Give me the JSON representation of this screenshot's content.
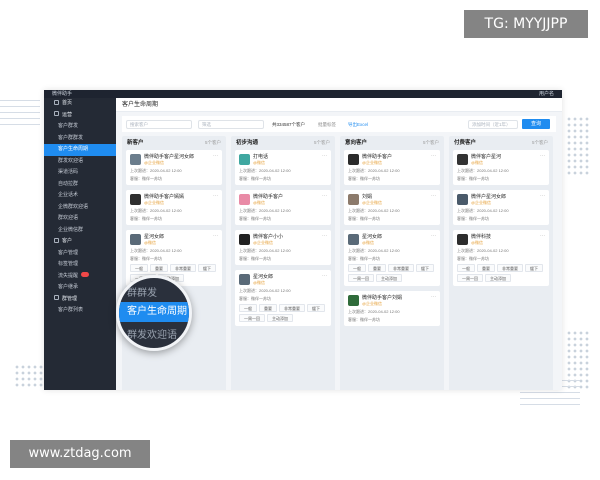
{
  "watermarks": {
    "top": "TG: MYYJJPP",
    "bottom": "www.ztdag.com"
  },
  "app": {
    "title": "微伴助手",
    "user": "用户名",
    "page_title": "客户生命周期",
    "accent": "#1f8cf0"
  },
  "sidebar": {
    "items": [
      {
        "label": "首页",
        "group": true
      },
      {
        "label": "运营",
        "group": true
      },
      {
        "label": "客户群发"
      },
      {
        "label": "客户群群发"
      },
      {
        "label": "客户生命周期",
        "active": true
      },
      {
        "label": "群发欢迎语"
      },
      {
        "label": "渠道活码"
      },
      {
        "label": "自动拉群"
      },
      {
        "label": "企业话术"
      },
      {
        "label": "企微群欢迎语"
      },
      {
        "label": "群欢迎语"
      },
      {
        "label": "企业微信群"
      },
      {
        "label": "客户",
        "group": true
      },
      {
        "label": "客户管理"
      },
      {
        "label": "标签管理"
      },
      {
        "label": "流失提醒",
        "badge": true
      },
      {
        "label": "客户继承"
      },
      {
        "label": "群管理",
        "group": true
      },
      {
        "label": "客户群列表"
      }
    ]
  },
  "lens": {
    "lines": [
      "群群发",
      "客户生命周期",
      "群发欢迎语"
    ]
  },
  "filter": {
    "search_placeholder": "搜索客户",
    "select_placeholder": "筛选",
    "total": "共334587个客户",
    "link1": "批量标签",
    "link2": "导出Excel",
    "date_placeholder": "添加时间（近1年）",
    "query": "查询"
  },
  "columns": [
    {
      "title": "新客户",
      "count": "5个客户",
      "cards": [
        {
          "name": "微伴助手客户星河女郎",
          "company": "@企业微信",
          "time": "上次跟进：2020-04-02 12:00",
          "owner": "客服：微伴一苏坊",
          "avatar": "#6b7d8c"
        },
        {
          "name": "微伴助手客户嫣嫣",
          "company": "@企业微信",
          "time": "上次跟进：2020-04-02 12:00",
          "owner": "客服：微伴一苏坊",
          "avatar": "#2f2f2f"
        },
        {
          "name": "星河女郎",
          "company": "@微信",
          "time": "上次跟进：2020-04-02 12:00",
          "owner": "客服：微伴一苏坊",
          "avatar": "#5a6a78",
          "tags": [
            "一般",
            "重要",
            "非常重要",
            "缓下",
            "一周一回",
            "主动添加"
          ]
        }
      ]
    },
    {
      "title": "初步沟通",
      "count": "5个客户",
      "cards": [
        {
          "name": "打电话",
          "company": "@微信",
          "time": "上次跟进：2020-04-02 12:00",
          "owner": "客服：微伴一苏坊",
          "avatar": "#3fa7a0"
        },
        {
          "name": "微伴助手客户",
          "company": "@微信",
          "time": "上次跟进：2020-04-02 12:00",
          "owner": "客服：微伴一苏坊",
          "avatar": "#e98aa6"
        },
        {
          "name": "微伴客户小小",
          "company": "@企业微信",
          "time": "上次跟进：2020-04-02 12:00",
          "owner": "客服：微伴一苏坊",
          "avatar": "#222222"
        },
        {
          "name": "星河女郎",
          "company": "@微信",
          "time": "上次跟进：2020-04-02 12:00",
          "owner": "客服：微伴一苏坊",
          "avatar": "#5a6a78",
          "tags": [
            "一般",
            "重要",
            "非常重要",
            "缓下",
            "一周一回",
            "主动添加"
          ]
        }
      ]
    },
    {
      "title": "意向客户",
      "count": "5个客户",
      "cards": [
        {
          "name": "微伴助手客户",
          "company": "@企业微信",
          "time": "上次跟进：2020-04-02 12:00",
          "owner": "客服：微伴一苏坊",
          "avatar": "#2b2b2b"
        },
        {
          "name": "刘娟",
          "company": "@企业微信",
          "time": "上次跟进：2020-04-02 12:00",
          "owner": "客服：微伴一苏坊",
          "avatar": "#8c7a6b"
        },
        {
          "name": "星河女郎",
          "company": "@微信",
          "time": "上次跟进：2020-04-02 12:00",
          "owner": "客服：微伴一苏坊",
          "avatar": "#5a6a78",
          "tags": [
            "一般",
            "重要",
            "非常重要",
            "缓下",
            "一周一回",
            "主动添加"
          ]
        },
        {
          "name": "微伴助手客户刘娟",
          "company": "@企业微信",
          "time": "上次跟进：2020-04-02 12:00",
          "owner": "客服：微伴一苏坊",
          "avatar": "#2f6b3a"
        }
      ]
    },
    {
      "title": "付费客户",
      "count": "5个客户",
      "cards": [
        {
          "name": "微伴客户星河",
          "company": "@微信",
          "time": "上次跟进：2020-04-02 12:00",
          "owner": "客服：微伴一苏坊",
          "avatar": "#333333"
        },
        {
          "name": "微伴户星河女郎",
          "company": "@企业微信",
          "time": "上次跟进：2020-04-02 12:00",
          "owner": "客服：微伴一苏坊",
          "avatar": "#4a5a6a"
        },
        {
          "name": "微伴科技",
          "company": "@微信",
          "time": "上次跟进：2020-04-02 12:00",
          "owner": "客服：微伴一苏坊",
          "avatar": "#2d2d2d",
          "tags": [
            "一般",
            "重要",
            "非常重要",
            "缓下",
            "一周一回",
            "主动添加"
          ]
        }
      ]
    }
  ]
}
